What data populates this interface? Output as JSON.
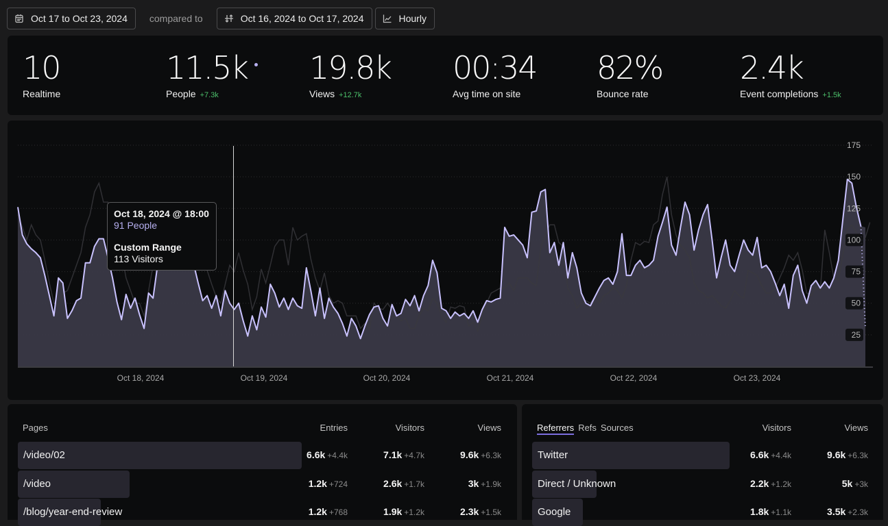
{
  "toolbar": {
    "date_range": "Oct 17 to Oct 23, 2024",
    "compared_label": "compared to",
    "compare_range": "Oct 16, 2024 to Oct 17, 2024",
    "interval": "Hourly"
  },
  "stats": [
    {
      "value": "10",
      "label": "Realtime",
      "delta": ""
    },
    {
      "value": "11.5k",
      "label": "People",
      "delta": "+7.3k"
    },
    {
      "value": "19.8k",
      "label": "Views",
      "delta": "+12.7k"
    },
    {
      "value": "00:34",
      "label": "Avg time on site",
      "delta": ""
    },
    {
      "value": "82%",
      "label": "Bounce rate",
      "delta": ""
    },
    {
      "value": "2.4k",
      "label": "Event completions",
      "delta": "+1.5k"
    }
  ],
  "tooltip": {
    "title": "Oct 18, 2024 @ 18:00",
    "people": "91 People",
    "compare_title": "Custom Range",
    "compare_value": "113 Visitors"
  },
  "colors": {
    "primary_line": "#c9c2ff",
    "area_fill": "#3a3947",
    "compare_line": "#2a2a2d",
    "delta_positive": "#4cbf6a"
  },
  "chart_data": {
    "type": "area",
    "title": "",
    "xlabel": "",
    "ylabel": "",
    "ylim": [
      0,
      175
    ],
    "y_ticks": [
      "25",
      "50",
      "75",
      "100",
      "125",
      "150",
      "175"
    ],
    "x_ticks": [
      "Oct 18, 2024",
      "Oct 19, 2024",
      "Oct 20, 2024",
      "Oct 21, 2024",
      "Oct 22, 2024",
      "Oct 23, 2024"
    ],
    "grid": true,
    "series": [
      {
        "name": "People",
        "values": [
          126,
          104,
          97,
          93,
          90,
          86,
          72,
          56,
          40,
          70,
          66,
          38,
          44,
          52,
          54,
          82,
          82,
          95,
          101,
          101,
          86,
          70,
          51,
          37,
          57,
          46,
          54,
          41,
          30,
          58,
          54,
          80,
          91,
          96,
          99,
          88,
          104,
          102,
          80,
          81,
          66,
          52,
          56,
          46,
          56,
          40,
          60,
          50,
          45,
          50,
          36,
          24,
          40,
          29,
          47,
          39,
          65,
          58,
          47,
          54,
          45,
          54,
          48,
          46,
          78,
          60,
          40,
          62,
          38,
          54,
          47,
          42,
          34,
          24,
          38,
          32,
          22,
          32,
          41,
          47,
          48,
          38,
          32,
          49,
          40,
          42,
          53,
          48,
          56,
          44,
          56,
          64,
          84,
          74,
          46,
          44,
          38,
          43,
          40,
          42,
          38,
          44,
          35,
          45,
          52,
          51,
          53,
          54,
          110,
          103,
          104,
          100,
          96,
          86,
          122,
          123,
          138,
          140,
          90,
          98,
          80,
          98,
          70,
          90,
          78,
          58,
          50,
          48,
          55,
          62,
          68,
          70,
          65,
          75,
          105,
          72,
          72,
          80,
          84,
          78,
          80,
          84,
          103,
          114,
          126,
          96,
          88,
          110,
          130,
          120,
          92,
          108,
          120,
          128,
          100,
          70,
          86,
          100,
          80,
          75,
          88,
          100,
          92,
          88,
          102,
          78,
          80,
          75,
          66,
          56,
          65,
          46,
          72,
          80,
          60,
          50,
          64,
          68,
          62,
          67,
          62,
          70,
          84,
          116,
          148,
          145,
          126,
          111,
          110
        ]
      },
      {
        "name": "Custom Range",
        "values": [
          120,
          110,
          100,
          112,
          104,
          100,
          84,
          66,
          50,
          48,
          58,
          60,
          70,
          80,
          90,
          110,
          120,
          138,
          145,
          130,
          130,
          113,
          100,
          90,
          70,
          60,
          50,
          50,
          40,
          60,
          80,
          96,
          107,
          107,
          125,
          100,
          111,
          111,
          90,
          80,
          80,
          90,
          76,
          65,
          55,
          50,
          65,
          80,
          75,
          90,
          76,
          65,
          45,
          55,
          77,
          66,
          80,
          95,
          100,
          100,
          80,
          110,
          100,
          103,
          105,
          85,
          70,
          60,
          74,
          56,
          50,
          52,
          50,
          40,
          40,
          40,
          30,
          34,
          30,
          50,
          46,
          45,
          50,
          45,
          40,
          36,
          38,
          30,
          30,
          40,
          46,
          44,
          54,
          50,
          40,
          35,
          47,
          46,
          48,
          47,
          32,
          35,
          28,
          40,
          50,
          58,
          60,
          62,
          62,
          66,
          60,
          70,
          70,
          70,
          66,
          64,
          94,
          104,
          112,
          112,
          98,
          95,
          62,
          56,
          46,
          50,
          52,
          50,
          55,
          50,
          56,
          58,
          62,
          60,
          54,
          64,
          84,
          98,
          96,
          99,
          98,
          112,
          115,
          136,
          150,
          120,
          104,
          96,
          92,
          86,
          66,
          60,
          58,
          54,
          56,
          52,
          48,
          46,
          52,
          60,
          56,
          54,
          76,
          74,
          72,
          64,
          58,
          58,
          62,
          70,
          78,
          88,
          84,
          90,
          76,
          58,
          56,
          62,
          60,
          108,
          90,
          70,
          68,
          88,
          108,
          112,
          106,
          100,
          102,
          114
        ]
      }
    ]
  },
  "pages": {
    "columns": [
      "Pages",
      "Entries",
      "Visitors",
      "Views"
    ],
    "rows": [
      {
        "name": "/video/02",
        "entries": "6.6k",
        "entries_delta": "+4.4k",
        "visitors": "7.1k",
        "visitors_delta": "+4.7k",
        "views": "9.6k",
        "views_delta": "+6.3k",
        "share": 1.0
      },
      {
        "name": "/video",
        "entries": "1.2k",
        "entries_delta": "+724",
        "visitors": "2.6k",
        "visitors_delta": "+1.7k",
        "views": "3k",
        "views_delta": "+1.9k",
        "share": 0.18
      },
      {
        "name": "/blog/year-end-review",
        "entries": "1.2k",
        "entries_delta": "+768",
        "visitors": "1.9k",
        "visitors_delta": "+1.2k",
        "views": "2.3k",
        "views_delta": "+1.5k",
        "share": 0.18
      }
    ]
  },
  "referrers": {
    "tabs": [
      "Referrers",
      "Refs",
      "Sources"
    ],
    "active_tab": "Referrers",
    "columns": [
      "Visitors",
      "Views"
    ],
    "rows": [
      {
        "name": "Twitter",
        "visitors": "6.6k",
        "visitors_delta": "+4.4k",
        "views": "9.6k",
        "views_delta": "+6.3k",
        "share": 1.0
      },
      {
        "name": "Direct / Unknown",
        "visitors": "2.2k",
        "visitors_delta": "+1.2k",
        "views": "5k",
        "views_delta": "+3k",
        "share": 0.33
      },
      {
        "name": "Google",
        "visitors": "1.8k",
        "visitors_delta": "+1.1k",
        "views": "3.5k",
        "views_delta": "+2.3k",
        "share": 0.27
      }
    ]
  }
}
